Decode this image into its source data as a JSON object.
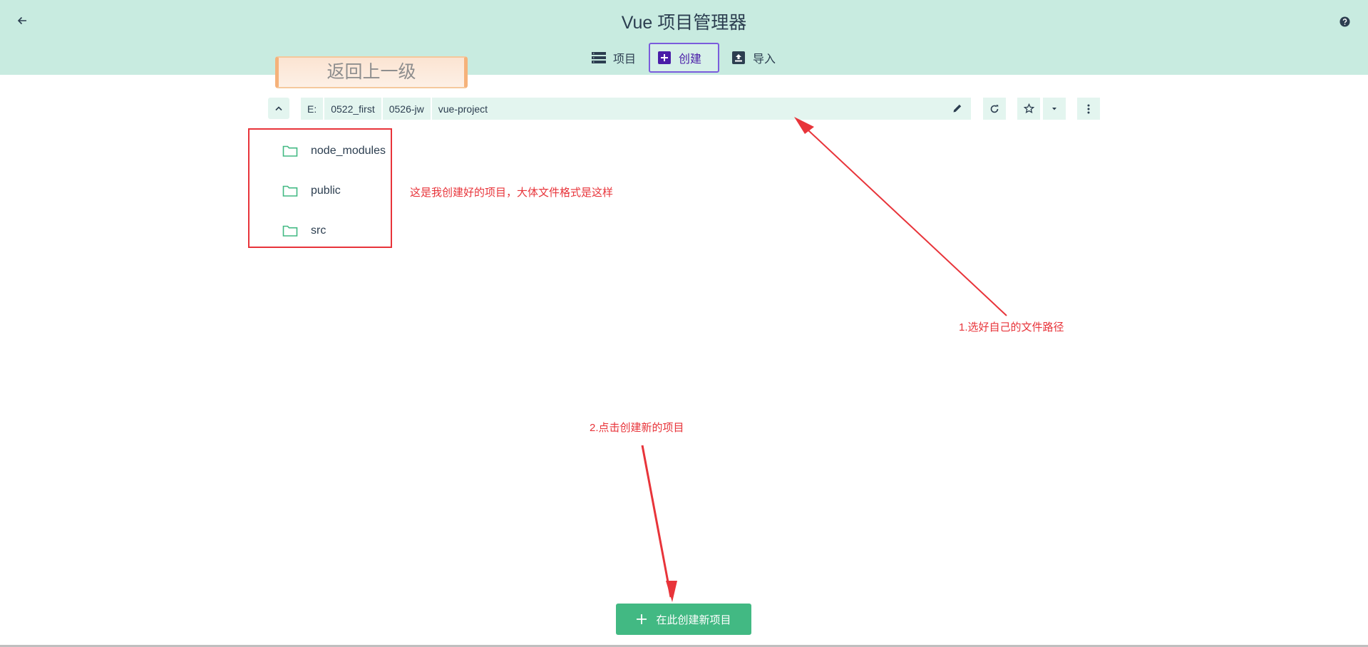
{
  "header": {
    "title": "Vue 项目管理器"
  },
  "tabs": [
    {
      "label": "项目",
      "icon": "list-icon"
    },
    {
      "label": "创建",
      "icon": "plus-box-icon",
      "active": true
    },
    {
      "label": "导入",
      "icon": "import-icon"
    }
  ],
  "callout": {
    "text": "返回上一级"
  },
  "path": {
    "crumbs": [
      "E:",
      "0522_first",
      "0526-jw",
      "vue-project"
    ]
  },
  "folders": [
    "node_modules",
    "public",
    "src"
  ],
  "annotations": {
    "folders_note": "这是我创建好的项目，大体文件格式是这样",
    "path_note": "1.选好自己的文件路径",
    "create_note": "2.点击创建新的项目"
  },
  "create_button": {
    "label": "在此创建新项目"
  },
  "colors": {
    "header_bg": "#c8ebe0",
    "accent": "#42b983",
    "annotation_red": "#e8343a",
    "tab_active_border": "#7b5cdc"
  }
}
